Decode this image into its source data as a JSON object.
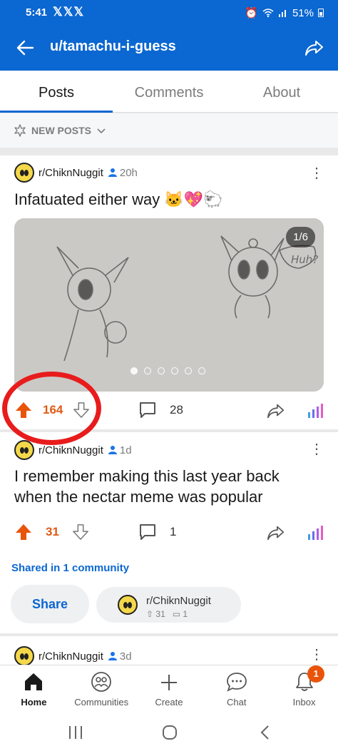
{
  "status_bar": {
    "time": "5:41",
    "notif_icons": "𝕏𝕏𝕏",
    "battery": "51%"
  },
  "header": {
    "title": "u/tamachu-i-guess"
  },
  "tabs": [
    {
      "label": "Posts"
    },
    {
      "label": "Comments"
    },
    {
      "label": "About"
    }
  ],
  "sort": {
    "label": "NEW POSTS"
  },
  "posts": [
    {
      "subreddit": "r/ChiknNuggit",
      "age": "20h",
      "title": "Infatuated either way 🐱💖🐑",
      "gallery_counter": "1/6",
      "gallery_pages": 6,
      "gallery_current": 1,
      "votes": "164",
      "comments": "28"
    },
    {
      "subreddit": "r/ChiknNuggit",
      "age": "1d",
      "title": "I remember making this last year back when the nectar meme was popular",
      "votes": "31",
      "comments": "1",
      "shared_label": "Shared in 1 community",
      "share_button": "Share",
      "crosspost": {
        "subreddit": "r/ChiknNuggit",
        "votes": "31",
        "comments": "1"
      }
    },
    {
      "subreddit": "r/ChiknNuggit",
      "age": "3d"
    }
  ],
  "bottom_nav": [
    {
      "label": "Home"
    },
    {
      "label": "Communities"
    },
    {
      "label": "Create"
    },
    {
      "label": "Chat"
    },
    {
      "label": "Inbox",
      "badge": "1"
    }
  ],
  "colors": {
    "brand": "#0b67d1",
    "upvote": "#e05a16",
    "annotation": "#e81c1c"
  }
}
